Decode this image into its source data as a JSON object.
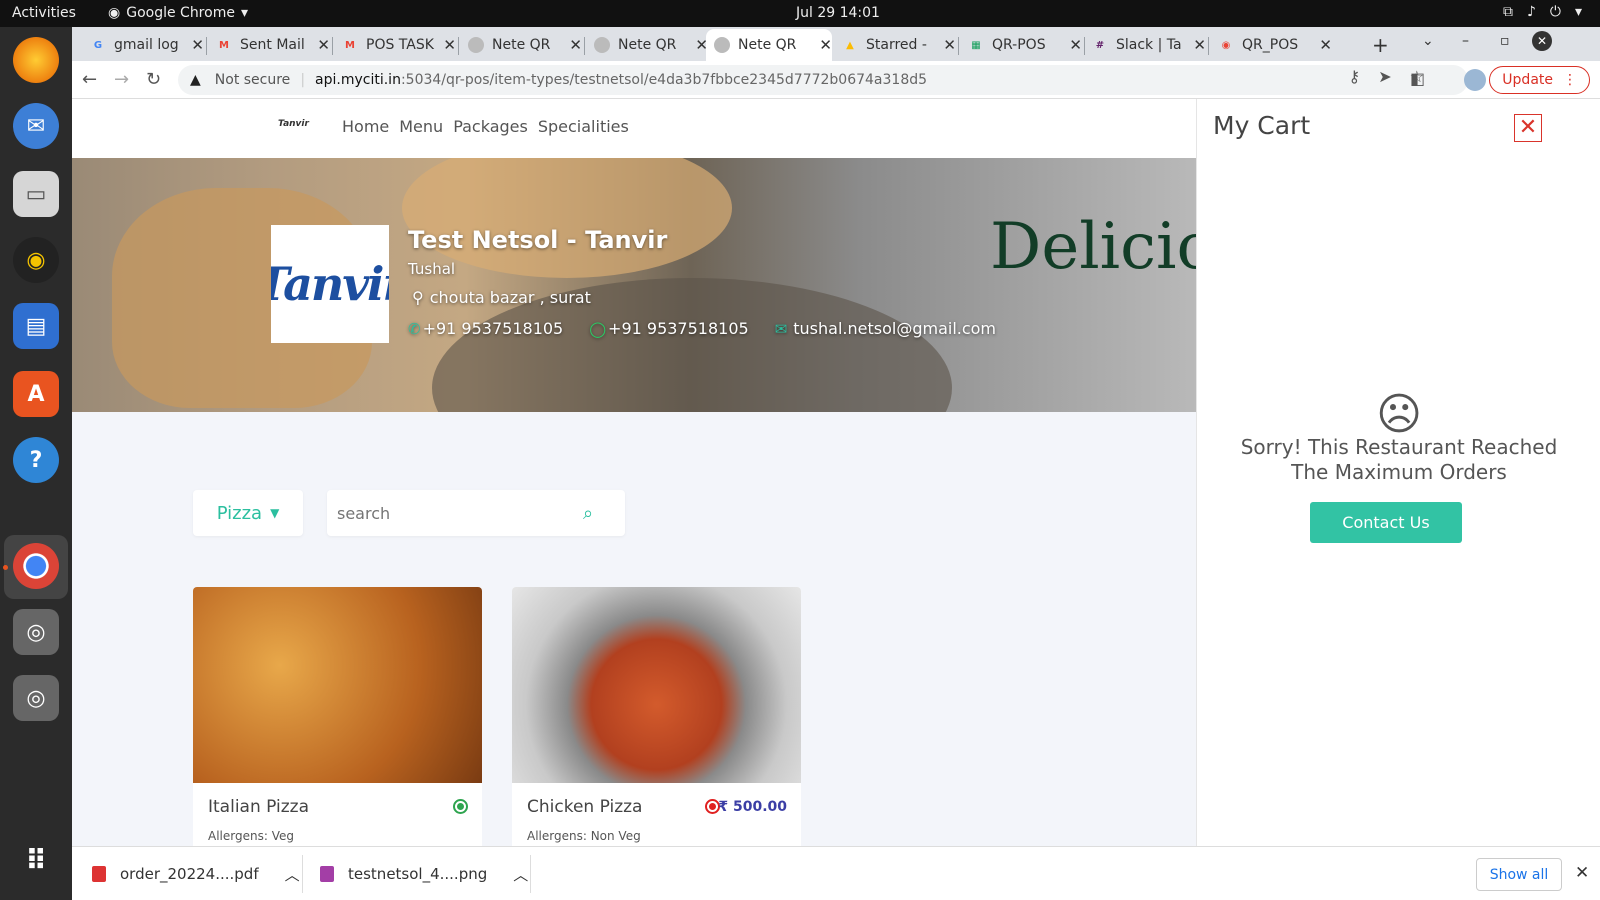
{
  "os": {
    "activities": "Activities",
    "app_name": "Google Chrome",
    "clock": "Jul 29  14:01"
  },
  "tabs": [
    {
      "title": "gmail log",
      "color": "#4285f4",
      "glyph": "G"
    },
    {
      "title": "Sent Mail",
      "color": "#ea4335",
      "glyph": "M"
    },
    {
      "title": "POS TASK",
      "color": "#ea4335",
      "glyph": "M"
    },
    {
      "title": "Nete QR",
      "color": "#888888",
      "glyph": ""
    },
    {
      "title": "Nete QR",
      "color": "#888888",
      "glyph": ""
    },
    {
      "title": "Nete QR",
      "color": "#888888",
      "glyph": ""
    },
    {
      "title": "Starred -",
      "color": "#fbbc04",
      "glyph": "▲"
    },
    {
      "title": "QR-POS",
      "color": "#0f9d58",
      "glyph": "▦"
    },
    {
      "title": "Slack | Ta",
      "color": "#611f69",
      "glyph": "#"
    },
    {
      "title": "QR_POS",
      "color": "#ea4335",
      "glyph": "◉"
    }
  ],
  "toolbar": {
    "security_label": "Not secure",
    "url_host": "api.myciti.in",
    "url_rest": ":5034/qr-pos/item-types/testnetsol/e4da3b7fbbce2345d7772b0674a318d5",
    "update_label": "Update"
  },
  "site": {
    "logo_text": "Tanvir",
    "nav": [
      "Home",
      "Menu",
      "Packages",
      "Specialities"
    ],
    "hero_text": "Delicious",
    "restaurant_name": "Test Netsol - Tanvir",
    "owner": "Tushal",
    "address": "chouta bazar , surat",
    "phone": "+91 9537518105",
    "whatsapp": "+91 9537518105",
    "email": "tushal.netsol@gmail.com",
    "brand_img_text": "Tanvir",
    "category_selected": "Pizza",
    "search_placeholder": "search"
  },
  "menu_items": [
    {
      "name": "Italian Pizza",
      "diet": "veg",
      "price": "",
      "allergens": "Allergens: Veg"
    },
    {
      "name": "Chicken Pizza",
      "diet": "nonveg",
      "price": "₹ 500.00",
      "allergens": "Allergens: Non Veg"
    }
  ],
  "cart": {
    "title": "My Cart",
    "message_line1": "Sorry! This Restaurant Reached",
    "message_line2": "The Maximum Orders",
    "contact_label": "Contact Us"
  },
  "downloads": {
    "items": [
      "order_20224....pdf",
      "testnetsol_4....png"
    ],
    "show_all": "Show all"
  },
  "colors": {
    "accent": "#32c3a4",
    "price": "#3b3ea5",
    "close": "#d9342b"
  }
}
